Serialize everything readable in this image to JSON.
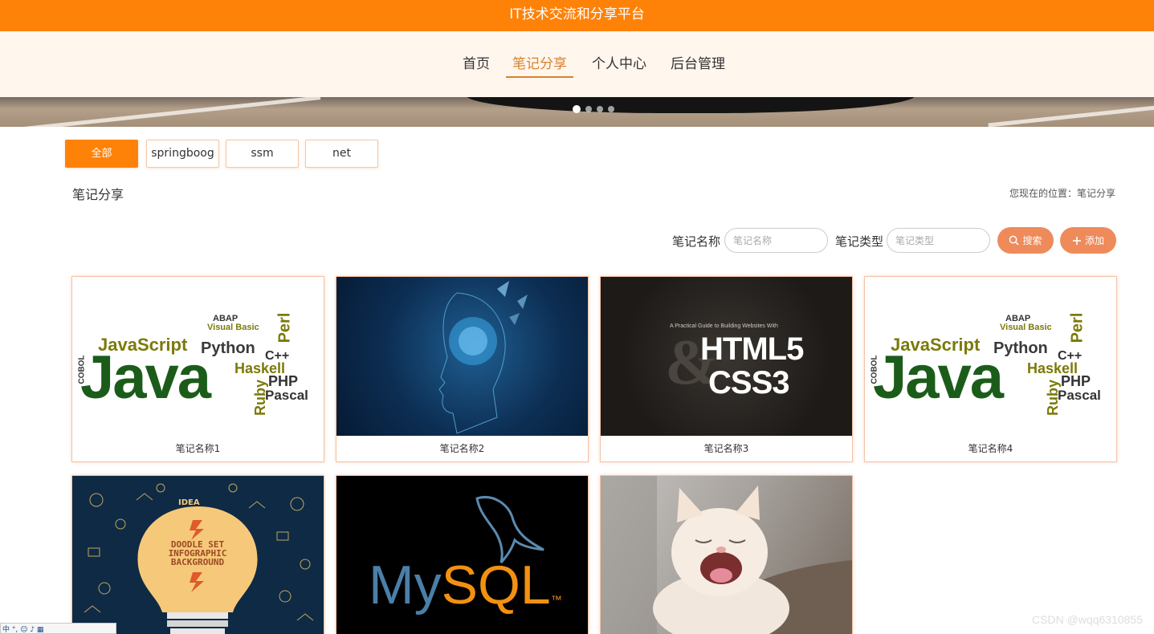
{
  "site_title": "IT技术交流和分享平台",
  "nav": [
    {
      "label": "首页",
      "active": false
    },
    {
      "label": "笔记分享",
      "active": true
    },
    {
      "label": "个人中心",
      "active": false
    },
    {
      "label": "后台管理",
      "active": false
    }
  ],
  "banner": {
    "slide_count": 4,
    "active_slide": 1
  },
  "categories": [
    "全部",
    "springboog",
    "ssm",
    "net"
  ],
  "section_title": "笔记分享",
  "breadcrumb": "您现在的位置：笔记分享",
  "search": {
    "name_label": "笔记名称",
    "name_placeholder": "笔记名称",
    "type_label": "笔记类型",
    "type_placeholder": "笔记类型",
    "search_button": "搜索",
    "add_button": "添加"
  },
  "thumb_text": {
    "java_word": "Java",
    "javascript": "JavaScript",
    "python": "Python",
    "haskell": "Haskell",
    "php": "PHP",
    "pascal": "Pascal",
    "ruby": "Ruby",
    "perl": "Perl",
    "cpp": "C++",
    "visual_basic": "Visual Basic",
    "abap": "ABAP",
    "cobol": "COBOL",
    "html_line1": "A Practical Guide to Building Websites With",
    "html5": "HTML5",
    "css3": "CSS3",
    "amp": "&",
    "bulb_text": "DOODLE SET INFOGRAPHIC BACKGROUND",
    "idea": "IDEA",
    "mysql_my": "My",
    "mysql_sql": "SQL",
    "mysql_tm": "™"
  },
  "notes": [
    {
      "name": "笔记名称1",
      "thumb": "java-wordcloud"
    },
    {
      "name": "笔记名称2",
      "thumb": "ai-brain"
    },
    {
      "name": "笔记名称3",
      "thumb": "html5-css3"
    },
    {
      "name": "笔记名称4",
      "thumb": "java-wordcloud"
    },
    {
      "name": "",
      "thumb": "lightbulb-doodle"
    },
    {
      "name": "",
      "thumb": "mysql-logo"
    },
    {
      "name": "",
      "thumb": "yawning-cat"
    }
  ],
  "watermark": "CSDN @wqq6310855",
  "ime_toolbar": "中 °, ☺ ♪ ▦"
}
